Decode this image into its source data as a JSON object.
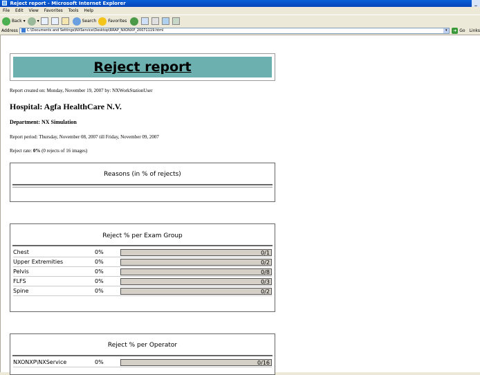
{
  "window": {
    "title": "Reject report - Microsoft Internet Explorer"
  },
  "menu": [
    "File",
    "Edit",
    "View",
    "Favorites",
    "Tools",
    "Help"
  ],
  "toolbar": {
    "back": "Back",
    "search": "Search",
    "favorites": "Favorites"
  },
  "address": {
    "label": "Address",
    "url": "C:\\Documents and Settings\\NXService\\Desktop\\RRAP_NXONXP_20071119.html",
    "go": "Go",
    "links": "Links"
  },
  "report": {
    "title": "Reject report",
    "created": "Report created on: Monday, November 19, 2007 by: NXWorkStationUser",
    "hospital": "Hospital: Agfa HealthCare N.V.",
    "department": "Department: NX Simulation",
    "period": "Report period: Thursday, November 08, 2007 till Friday, November 09, 2007",
    "reject_rate_label": "Reject rate: ",
    "reject_rate_value": "0%",
    "reject_rate_detail": " (0 rejects of 16 images)"
  },
  "reasons": {
    "title": "Reasons (in % of rejects)"
  },
  "exam_groups": {
    "title": "Reject % per Exam Group",
    "rows": [
      {
        "label": "Chest",
        "pct": "0%",
        "ratio": "0/1",
        "fill": 0
      },
      {
        "label": "Upper Extremities",
        "pct": "0%",
        "ratio": "0/2",
        "fill": 0
      },
      {
        "label": "Pelvis",
        "pct": "0%",
        "ratio": "0/8",
        "fill": 0
      },
      {
        "label": "FLFS",
        "pct": "0%",
        "ratio": "0/3",
        "fill": 0
      },
      {
        "label": "Spine",
        "pct": "0%",
        "ratio": "0/2",
        "fill": 0
      }
    ]
  },
  "operators": {
    "title": "Reject % per Operator",
    "rows": [
      {
        "label": "NXONXP\\NXService",
        "pct": "0%",
        "ratio": "0/16",
        "fill": 0
      }
    ]
  }
}
